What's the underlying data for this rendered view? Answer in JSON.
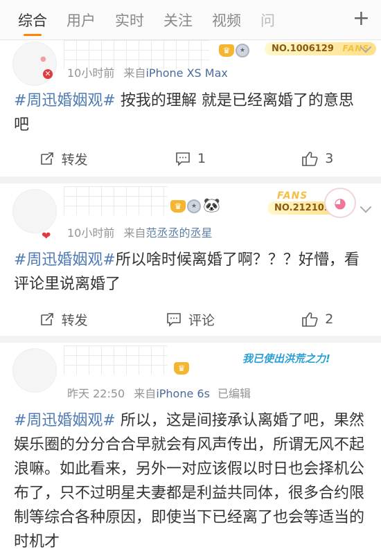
{
  "tabs": [
    {
      "label": "综合",
      "active": true
    },
    {
      "label": "用户"
    },
    {
      "label": "实时"
    },
    {
      "label": "关注"
    },
    {
      "label": "视频"
    },
    {
      "label": "问"
    }
  ],
  "tab_plus": "+",
  "posts": [
    {
      "time": "10小时前",
      "source_prefix": "来自",
      "source": "iPhone XS Max",
      "fans_no": "NO.1006129",
      "fans_label": "FANS",
      "hashtag": "#周迅婚姻观#",
      "body": " 按我的理解 就是已经离婚了的意思吧",
      "actions": {
        "repost": "转发",
        "comment": "1",
        "like": "3"
      }
    },
    {
      "time": "10小时前",
      "source_prefix": "来自",
      "source": "范丞丞的丞星",
      "fans_no": "NO.212109",
      "fans_label": "FANS",
      "hashtag": "#周迅婚姻观#",
      "body": "所以啥时候离婚了啊？？？好懵，看评论里说离婚了",
      "actions": {
        "repost": "转发",
        "comment": "评论",
        "like": "2"
      }
    },
    {
      "time": "昨天 22:50",
      "source_prefix": "来自",
      "source": "iPhone 6s",
      "edited": "已编辑",
      "banner": "我已使出洪荒之力!",
      "hashtag": "#周迅婚姻观#",
      "body": " 所以，这是间接承认离婚了吧，果然娱乐圈的分分合合早就会有风声传出，所谓无风不起浪嘛。如此看来，另外一对应该假以时日也会择机公布了，只不过明星夫妻都是利益共同体，很多合约限制等综合各种原因，即使当下已经离了也会等适当的时机才"
    }
  ],
  "colors": {
    "accent": "#ff8200",
    "link": "#4e7bb5",
    "meta": "#939393"
  }
}
